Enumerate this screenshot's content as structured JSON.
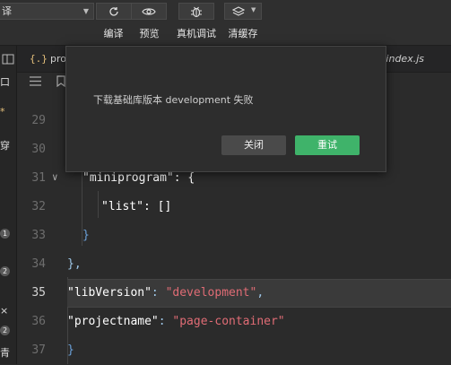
{
  "toolbar": {
    "mode_select_value": "译",
    "compile_label": "编译",
    "preview_label": "预览",
    "remote_debug_label": "真机调试",
    "clear_cache_label": "清缓存"
  },
  "tabs": {
    "active_icon": "{.}",
    "active_name": "pro",
    "right_tab": "index.js"
  },
  "left_strip": {
    "glyphs": [
      "口",
      "*",
      "穿",
      "×",
      "青"
    ],
    "badges": [
      "1",
      "2",
      "2"
    ]
  },
  "editor": {
    "lines": [
      {
        "n": "29"
      },
      {
        "n": "30"
      },
      {
        "n": "31",
        "text": "\"miniprogram\": {"
      },
      {
        "n": "32",
        "text": "\"list\": []"
      },
      {
        "n": "33",
        "text": "}"
      },
      {
        "n": "34",
        "text": "},"
      },
      {
        "n": "35",
        "key": "\"libVersion\"",
        "value": "\"development\""
      },
      {
        "n": "36",
        "key": "\"projectname\"",
        "value": "\"page-container\""
      },
      {
        "n": "37",
        "text": "}"
      }
    ]
  },
  "dialog": {
    "message": "下载基础库版本 development 失败",
    "close_label": "关闭",
    "retry_label": "重试"
  },
  "colors": {
    "retry": "#3fb36a",
    "string": "#e06c75",
    "background": "#2b2b2b"
  }
}
